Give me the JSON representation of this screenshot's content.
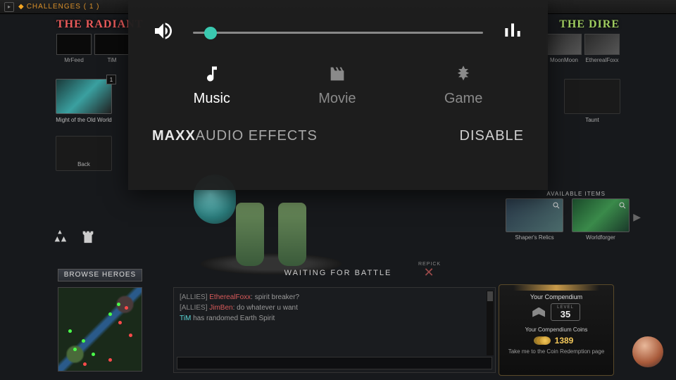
{
  "topbar": {
    "challenges": "CHALLENGES ( 1 )"
  },
  "teams": {
    "radiant": {
      "label": "THE RADIANT",
      "players": [
        "MrFeed",
        "TiM",
        "",
        "",
        ""
      ]
    },
    "dire": {
      "label": "THE DIRE",
      "players": [
        "",
        "",
        "",
        "MoonMoon",
        "EtherealFoxx"
      ]
    }
  },
  "left_item": {
    "name": "Might of the Old World",
    "badge": "1"
  },
  "back_label": "Back",
  "taunt_label": "Taunt",
  "browse_heroes": "BROWSE HEROES",
  "waiting": "WAITING FOR BATTLE",
  "repick": "REPICK",
  "available": {
    "label": "AVAILABLE ITEMS",
    "items": [
      "Shaper's Relics",
      "Worldforger"
    ]
  },
  "chat": {
    "lines": [
      {
        "channel": "[ALLIES]",
        "player": "EtherealFoxx",
        "color": "red",
        "msg": "spirit breaker?"
      },
      {
        "channel": "[ALLIES]",
        "player": "JimBen",
        "color": "red",
        "msg": "do whatever u want"
      },
      {
        "channel": "",
        "player": "TiM",
        "color": "cyan",
        "msg": "has randomed Earth Spirit"
      }
    ]
  },
  "compendium": {
    "title": "Your Compendium",
    "level_label": "LEVEL",
    "level": "35",
    "coins_title": "Your Compendium Coins",
    "coins": "1389",
    "redeem": "Take me to the Coin Redemption page"
  },
  "overlay": {
    "volume_percent": 6,
    "modes": {
      "music": "Music",
      "movie": "Movie",
      "game": "Game",
      "active": "music"
    },
    "effects_bold": "MAXX",
    "effects_rest": "AUDIO EFFECTS",
    "disable": "DISABLE"
  },
  "colors": {
    "accent": "#3ac9b0",
    "gold": "#f5c95a"
  }
}
